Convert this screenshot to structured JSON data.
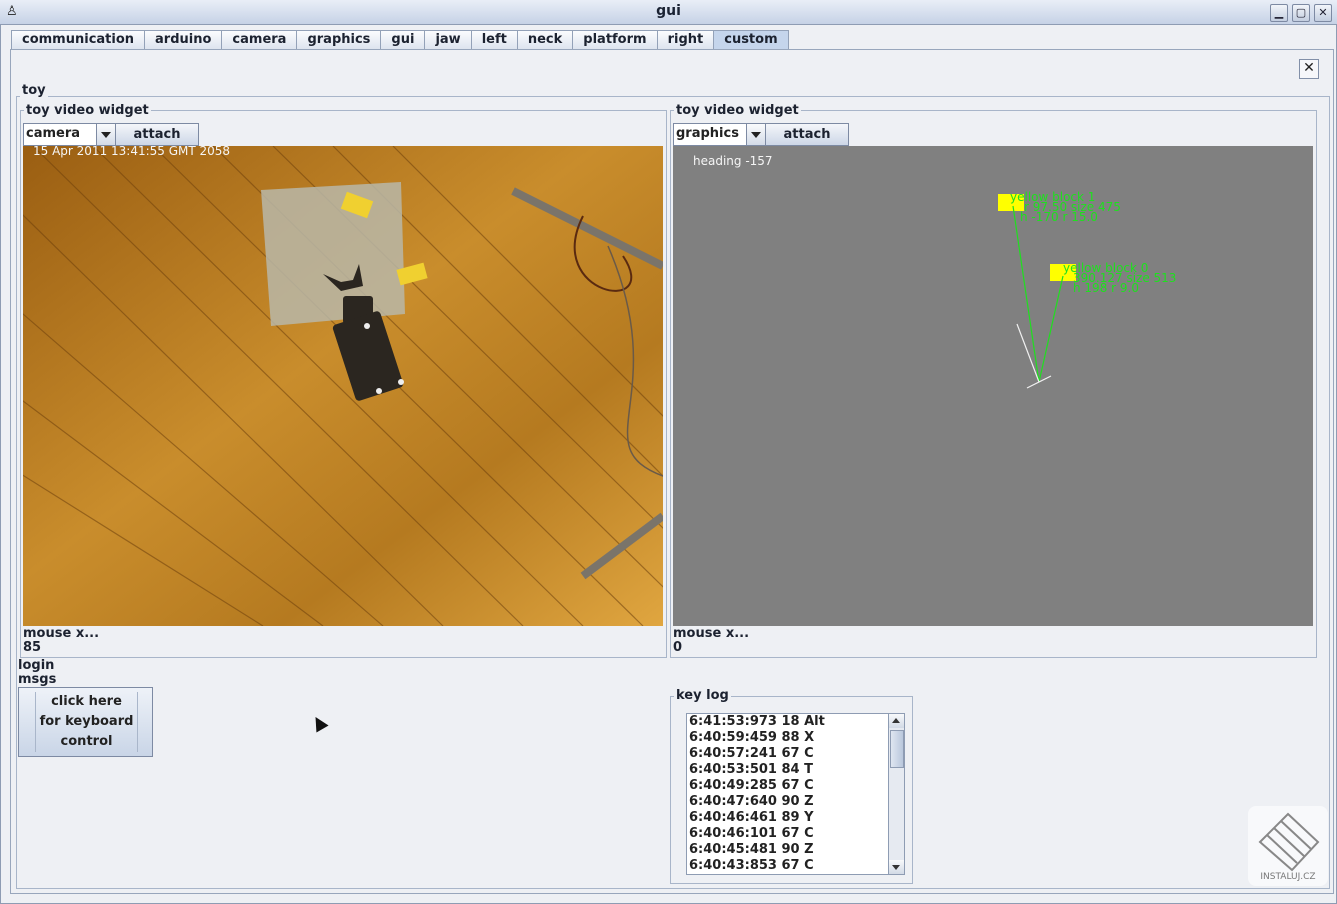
{
  "window": {
    "title": "gui"
  },
  "tabs": [
    "communication",
    "arduino",
    "camera",
    "graphics",
    "gui",
    "jaw",
    "left",
    "neck",
    "platform",
    "right",
    "custom"
  ],
  "active_tab": "custom",
  "close_symbol": "✕",
  "panel": {
    "title": "toy"
  },
  "left_widget": {
    "title": "toy  video widget",
    "source": "camera",
    "attach_label": "attach",
    "timestamp": "15 Apr 2011 13:41:55 GMT 2058",
    "mouse_label": "mouse x...",
    "mouse_value": "85"
  },
  "right_widget": {
    "title": "toy  video widget",
    "source": "graphics",
    "attach_label": "attach",
    "heading": "heading -157",
    "blocks": [
      {
        "name": "yellow block 1",
        "line2": "r 97.50 size 475",
        "line3": "h -170 r 15.0"
      },
      {
        "name": "yellow block 0",
        "line2": "390.127 size 513",
        "line3": "h 198 r 9.0"
      }
    ],
    "mouse_label": "mouse x...",
    "mouse_value": "0"
  },
  "login": {
    "label": "login"
  },
  "msgs": {
    "label": "msgs"
  },
  "keyboard_button": {
    "line1": "click here",
    "line2": "for keyboard",
    "line3": "control"
  },
  "key_log": {
    "title": "key log",
    "entries": [
      "6:41:53:973 18 Alt",
      "6:40:59:459 88 X",
      "6:40:57:241 67 C",
      "6:40:53:501 84 T",
      "6:40:49:285 67 C",
      "6:40:47:640 90 Z",
      "6:40:46:461 89 Y",
      "6:40:46:101 67 C",
      "6:40:45:481 90 Z",
      "6:40:43:853 67 C"
    ]
  },
  "watermark": {
    "text": "INSTALUJ.CZ"
  },
  "colors": {
    "accent": "#c5d5ec",
    "overlay_green": "#1ee01e",
    "block_yellow": "#ffff00",
    "graph_bg": "#808080"
  }
}
